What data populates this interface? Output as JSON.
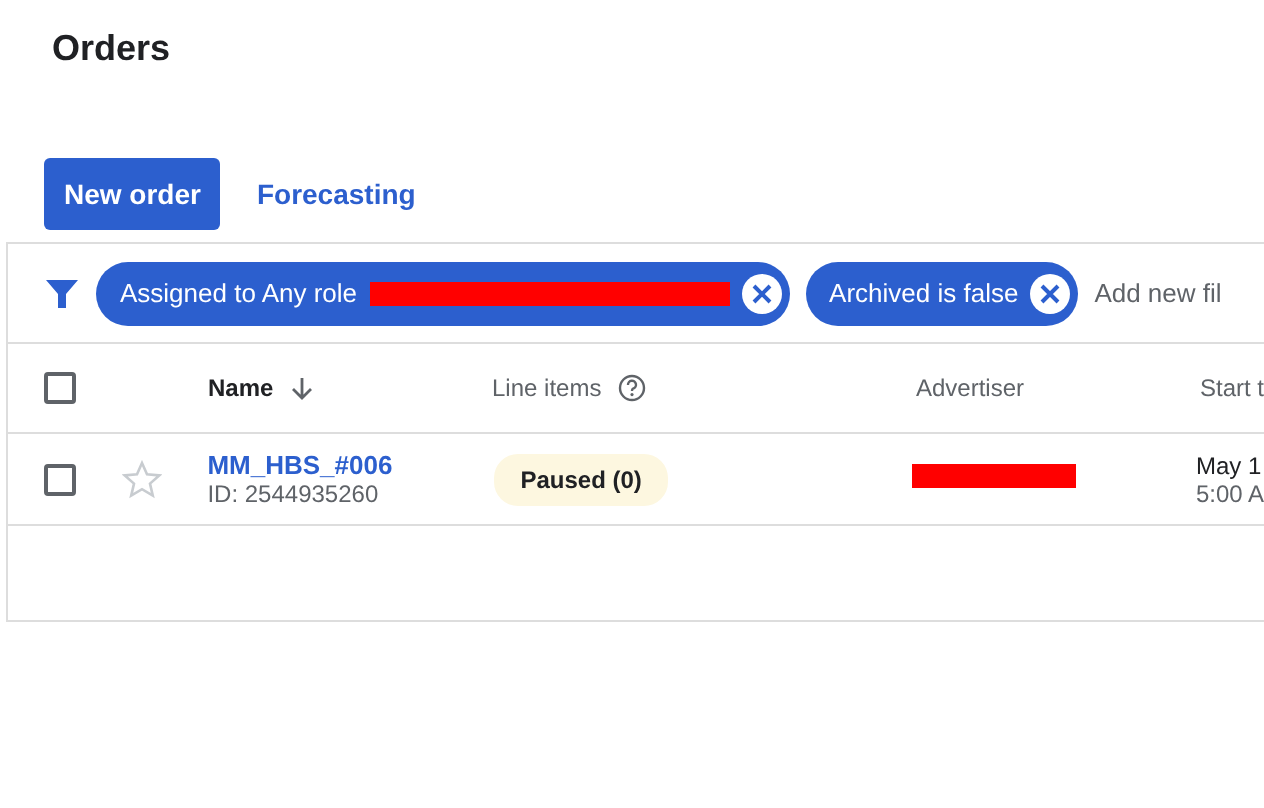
{
  "title": "Orders",
  "tabs": [
    {
      "label": "New order",
      "selected": true
    },
    {
      "label": "Forecasting",
      "selected": false
    }
  ],
  "filters": [
    {
      "label": "Assigned to Any role",
      "redacted": true
    },
    {
      "label": "Archived is false",
      "redacted": false
    }
  ],
  "add_filter": "Add new fil",
  "table": {
    "select_all_checked": false,
    "columns": [
      {
        "label": "Name",
        "sorted": true,
        "help": false
      },
      {
        "label": "Line items",
        "sorted": false,
        "help": true
      },
      {
        "label": "Advertiser",
        "sorted": false,
        "help": false
      },
      {
        "label": "Start t",
        "sorted": false,
        "help": false
      }
    ],
    "rows": [
      {
        "checked": false,
        "starred": false,
        "name": "MM_HBS_#006",
        "id": "ID: 2544935260",
        "status": "Paused (0)",
        "advertiser_redacted": true,
        "start_date": "May 1",
        "start_time": "5:00 A"
      }
    ]
  }
}
